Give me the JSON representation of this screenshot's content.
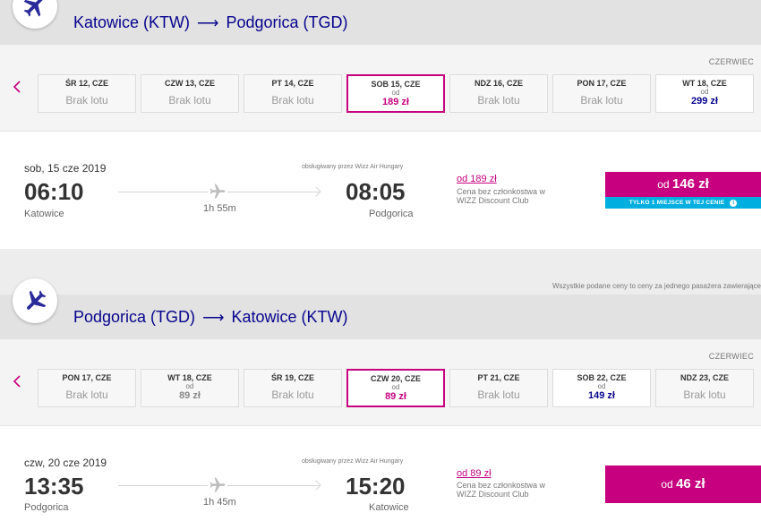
{
  "colors": {
    "brand_navy": "#06038d",
    "brand_magenta": "#c6007e",
    "info_blue": "#00aee0"
  },
  "outbound": {
    "route": {
      "from": "Katowice (KTW)",
      "arrow": "⟶",
      "to": "Podgorica (TGD)"
    },
    "month": "CZERWIEC",
    "days": [
      {
        "day": "ŚR 12, CZE",
        "status": "Brak lotu"
      },
      {
        "day": "CZW 13, CZE",
        "status": "Brak lotu"
      },
      {
        "day": "PT 14, CZE",
        "status": "Brak lotu"
      },
      {
        "day": "SOB 15, CZE",
        "od": "od",
        "price": "189 zł"
      },
      {
        "day": "NDZ 16, CZE",
        "status": "Brak lotu"
      },
      {
        "day": "PON 17, CZE",
        "status": "Brak lotu"
      },
      {
        "day": "WT 18, CZE",
        "od": "od",
        "price": "299 zł"
      }
    ],
    "flight": {
      "date": "sob, 15 cze 2019",
      "operated_by": "obsługiwany przez Wizz Air Hungary",
      "dep_time": "06:10",
      "dep_city": "Katowice",
      "arr_time": "08:05",
      "arr_city": "Podgorica",
      "duration": "1h 55m",
      "member_price": "od  189 zł",
      "member_note": "Cena bez członkostwa w WIZZ Discount Club",
      "price_prefix": "od",
      "price": "146 zł",
      "seats_note": "TYLKO 1 MIEJSCE W TEJ CENIE",
      "seats_icon": "i"
    }
  },
  "disclaimer": "Wszystkie podane ceny to ceny za jednego pasażera zawierające",
  "inbound": {
    "route": {
      "from": "Podgorica (TGD)",
      "arrow": "⟶",
      "to": "Katowice (KTW)"
    },
    "month": "CZERWIEC",
    "days": [
      {
        "day": "PON 17, CZE",
        "status": "Brak lotu"
      },
      {
        "day": "WT 18, CZE",
        "od": "od",
        "price": "89 zł"
      },
      {
        "day": "ŚR 19, CZE",
        "status": "Brak lotu"
      },
      {
        "day": "CZW 20, CZE",
        "od": "od",
        "price": "89 zł"
      },
      {
        "day": "PT 21, CZE",
        "status": "Brak lotu"
      },
      {
        "day": "SOB 22, CZE",
        "od": "od",
        "price": "149 zł"
      },
      {
        "day": "NDZ 23, CZE",
        "status": "Brak lotu"
      }
    ],
    "flight": {
      "date": "czw, 20 cze 2019",
      "operated_by": "obsługiwany przez Wizz Air Hungary",
      "dep_time": "13:35",
      "dep_city": "Podgorica",
      "arr_time": "15:20",
      "arr_city": "Katowice",
      "duration": "1h 45m",
      "member_price": "od  89 zł",
      "member_note": "Cena bez członkostwa w WIZZ Discount Club",
      "price_prefix": "od",
      "price": "46 zł"
    }
  }
}
